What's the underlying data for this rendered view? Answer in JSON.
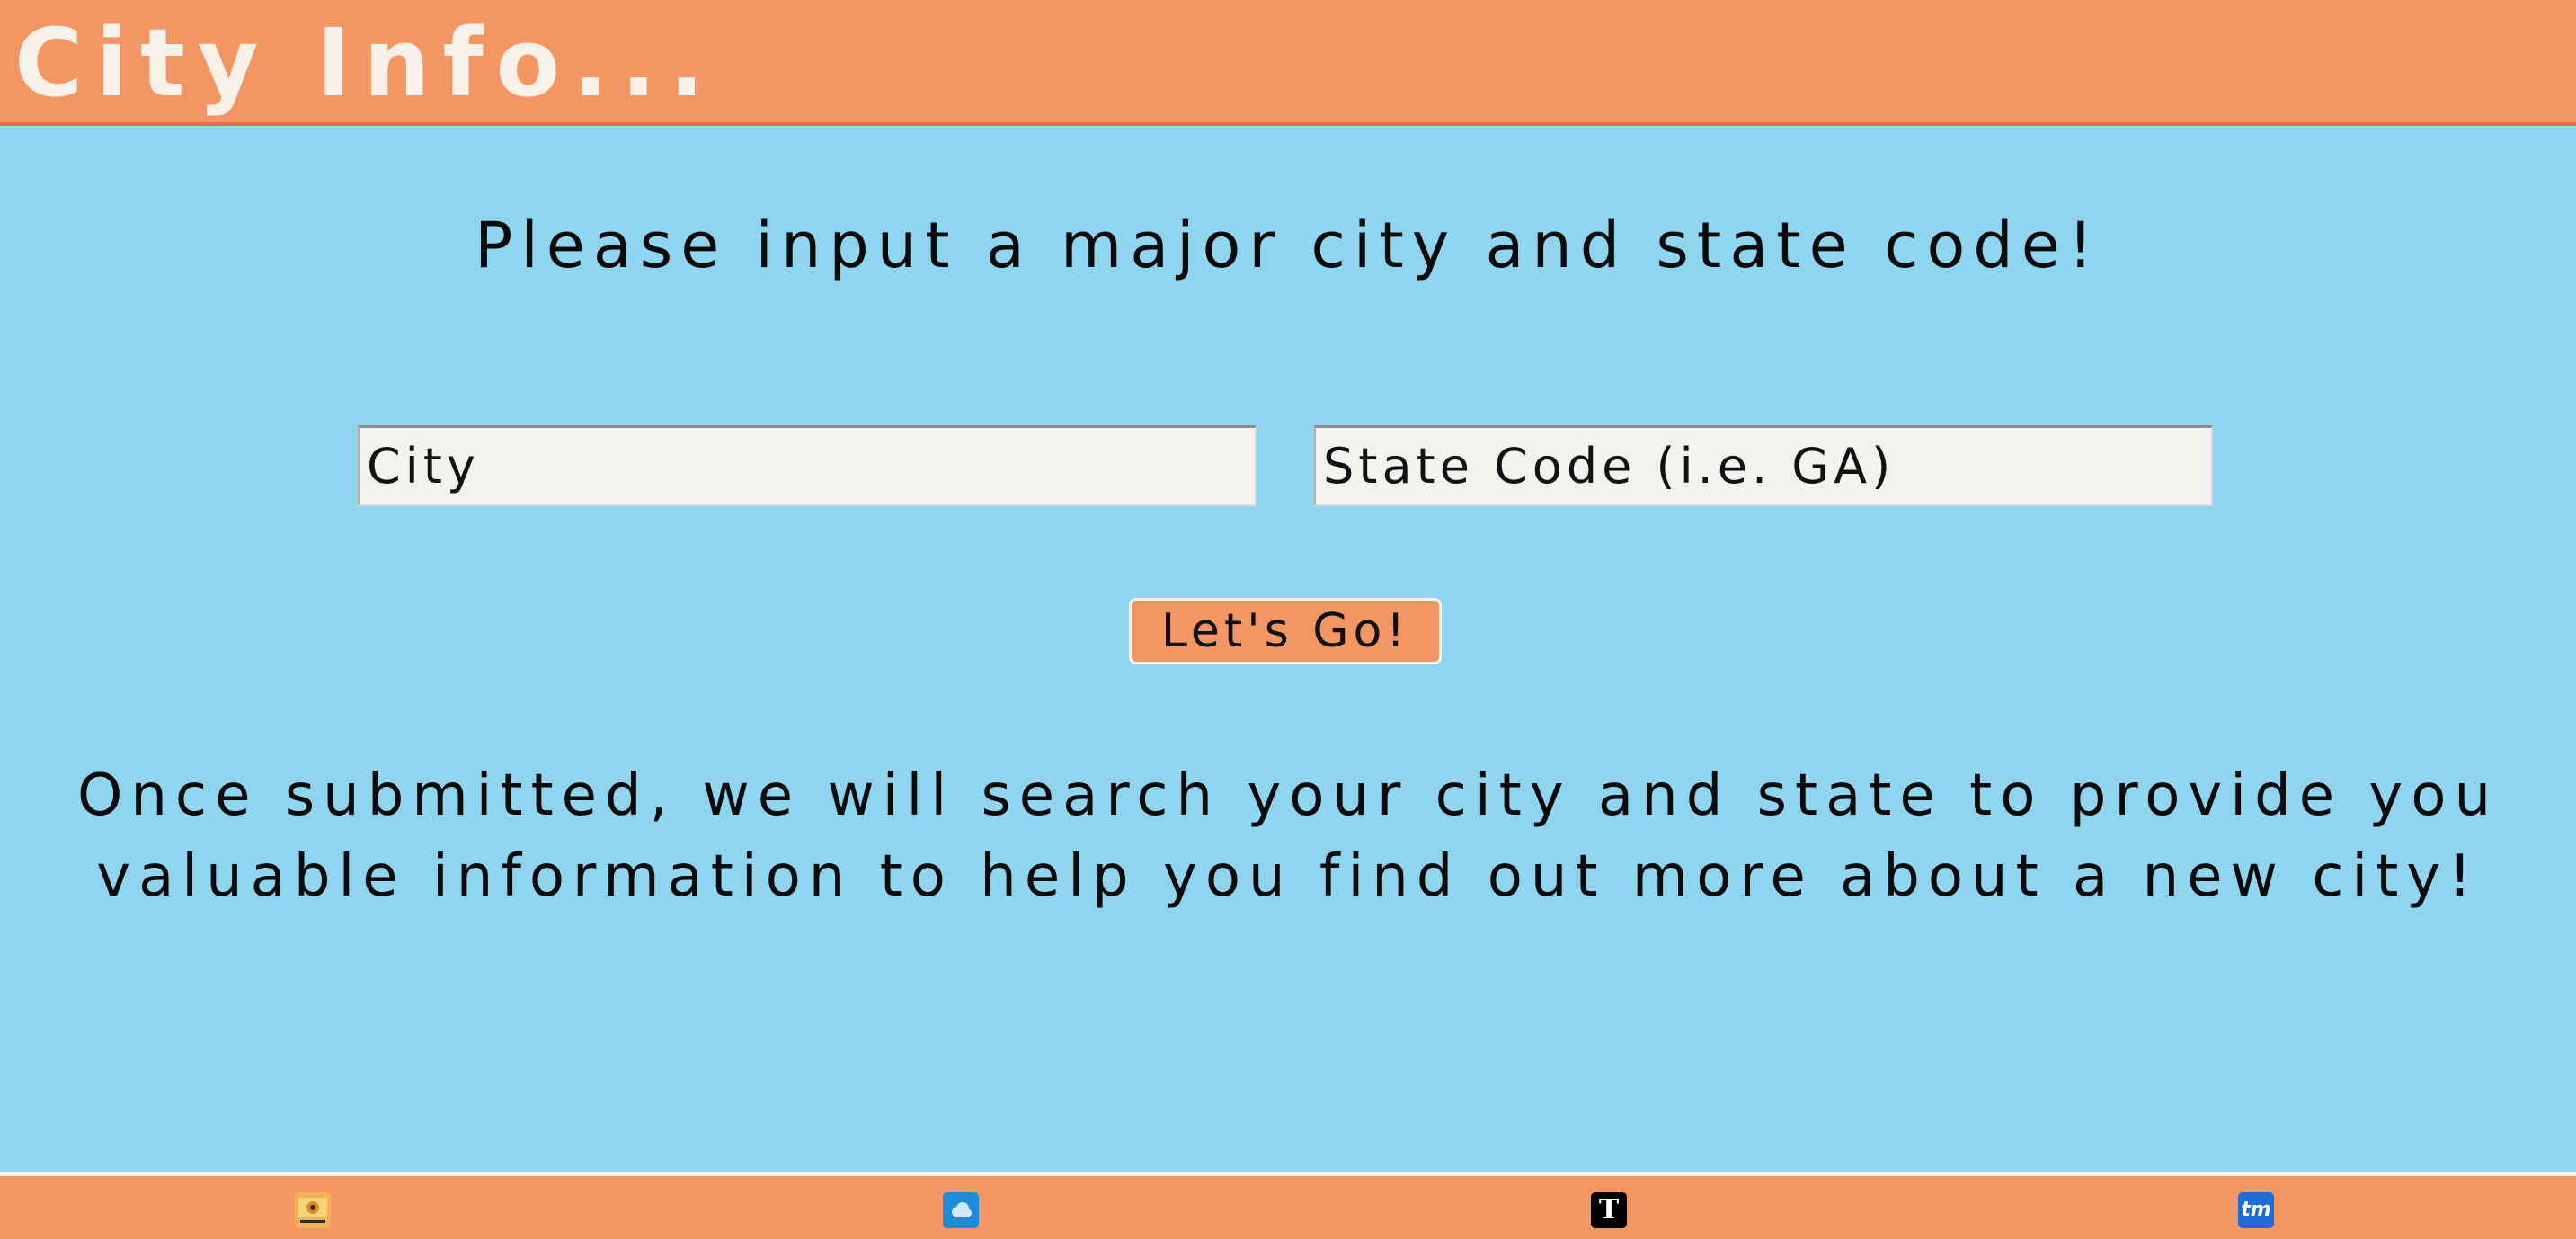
{
  "header": {
    "title": "City Info..."
  },
  "main": {
    "prompt": "Please input a major city and state code!",
    "city_input": {
      "value": "",
      "placeholder": "City"
    },
    "state_input": {
      "value": "",
      "placeholder": "State Code (i.e. GA)"
    },
    "submit_label": "Let's Go!",
    "description": "Once submitted, we will search your city and state to provide you valuable information to help you find out more about a new city!"
  },
  "footer": {
    "links": [
      {
        "icon": "sun-logo-icon"
      },
      {
        "icon": "weather-cloud-icon"
      },
      {
        "icon": "nyt-logo-icon",
        "glyph": "T"
      },
      {
        "icon": "ticketmaster-icon",
        "glyph": "tm"
      }
    ]
  },
  "colors": {
    "header_bg": "#f39663",
    "page_bg": "#90d5f0",
    "title_text": "#f7f1ea",
    "input_bg": "#f4f2ee"
  }
}
